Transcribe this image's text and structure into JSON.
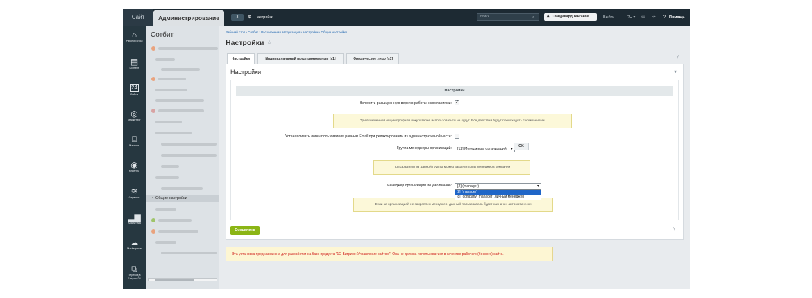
{
  "topbar": {
    "site_tab": "Сайт",
    "admin_tab": "Администрирование",
    "badge": "3",
    "settings_link": "Настройки",
    "search_placeholder": "поиск...",
    "user_name": "Скандавард Тенгансе",
    "logout": "Выйти",
    "lang": "RU",
    "help": "Помощь"
  },
  "iconbar": {
    "items": [
      {
        "label": "Рабочий стол",
        "icon": "home-icon"
      },
      {
        "label": "Контент",
        "icon": "document-icon"
      },
      {
        "label": "Сайты",
        "icon": "calendar-icon"
      },
      {
        "label": "Маркетинг",
        "icon": "target-icon"
      },
      {
        "label": "Магазин",
        "icon": "cart-icon"
      },
      {
        "label": "Клиенты",
        "icon": "clients-icon"
      },
      {
        "label": "Сервисы",
        "icon": "layers-icon"
      },
      {
        "label": "Аналитика",
        "icon": "bar-chart-icon"
      },
      {
        "label": "Marketplace",
        "icon": "cloud-icon"
      },
      {
        "label": "Переход в Битрикс24",
        "icon": "bitrix-icon"
      }
    ]
  },
  "tree": {
    "title": "Сотбит",
    "active_item": "Общие настройки"
  },
  "breadcrumb": [
    "Рабочий стол",
    "Сотбит",
    "Расширенная авторизация",
    "Настройки",
    "Общие настройки"
  ],
  "page": {
    "title": "Настройки",
    "tabs": [
      "Настройки",
      "Индивидуальный предприниматель [s1]",
      "Юридическое лицо [s1]"
    ],
    "panel_title": "Настройки",
    "section_header": "Настройки",
    "extended_label": "Включить расширенную версию работы с компаниями:",
    "extended_checked": true,
    "note1": "При включенной опции профили покупателей использоваться не будут. Все действия будут происходить с компаниями.",
    "login_label": "Устанавливать логин пользователя равным Email при редактировании из административной части:",
    "login_checked": false,
    "managers_group_label": "Группа менеджеры организаций:",
    "managers_group_value": "[12] Менеджеры организаций",
    "ok_label": "OK",
    "note2": "Пользователи из данной группы можно закрепить как менеджера компании",
    "default_manager_label": "Менеджер организации по умолчанию:",
    "default_manager_value": "[2] (manager)",
    "dropdown_options": [
      "[2] (manager)",
      "[8] (company_manager) Личный менеджер"
    ],
    "note3": "Если за организацией не закреплен менеджер, данный пользователь будет назначен автоматически",
    "save_label": "Сохранить",
    "warning": "Эта установка предназначена для разработки на базе продукта \"1С-Битрикс: Управление сайтом\". Она не должна использоваться в качестве рабочего (боевого) сайта."
  },
  "colors": {
    "topbar": "#1d2a33",
    "sidebar": "#263740",
    "save_button": "#8bb515",
    "warning_text": "#d0231f",
    "dropdown_highlight": "#1f65c8"
  }
}
